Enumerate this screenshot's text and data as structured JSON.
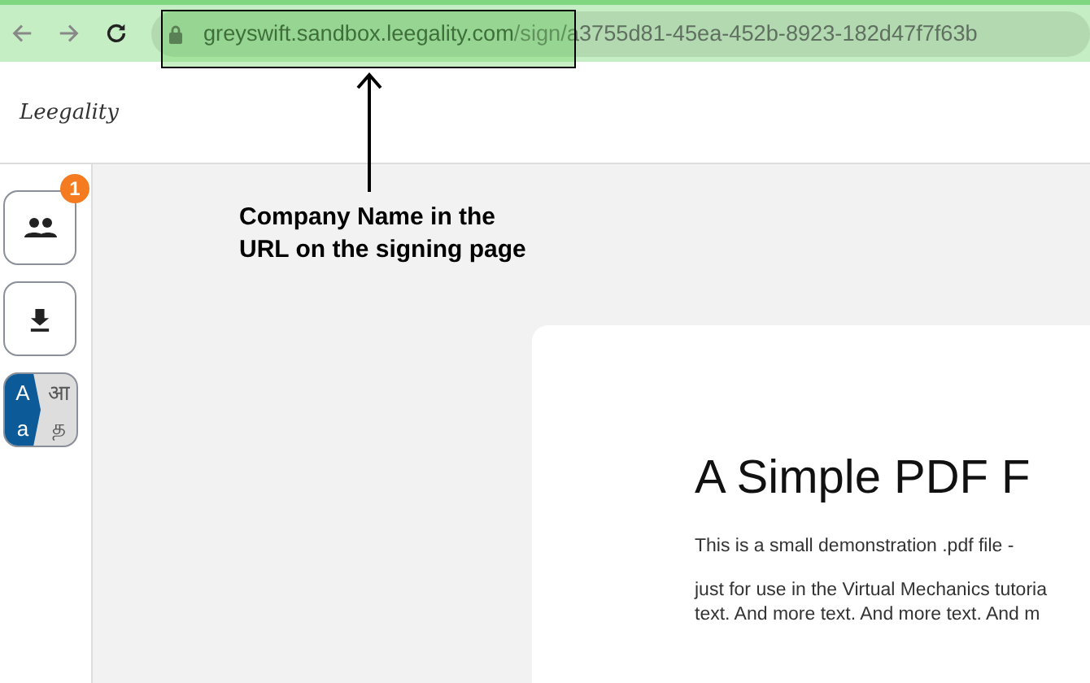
{
  "browser": {
    "url_host": "greyswift.sandbox.leegality.com",
    "url_path": "/sign/a3755d81-45ea-452b-8923-182d47f7f63b"
  },
  "annotation": {
    "text": "Company Name in the URL on the signing page"
  },
  "header": {
    "logo": "Leegality"
  },
  "sidebar": {
    "items": [
      {
        "kind": "people",
        "badge": "1"
      },
      {
        "kind": "download"
      },
      {
        "kind": "language",
        "latin_upper": "A",
        "latin_lower": "a",
        "other_upper": "आ",
        "other_lower": "த"
      }
    ]
  },
  "document": {
    "title": "A Simple PDF F",
    "lines": [
      "This is a small demonstration .pdf file -",
      "just for use in the Virtual Mechanics tutoria",
      "text. And more text. And more text. And m"
    ]
  }
}
